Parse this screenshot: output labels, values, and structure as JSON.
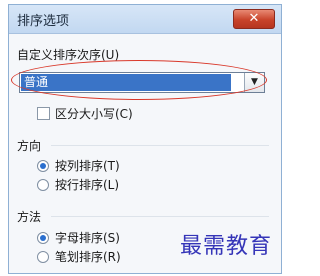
{
  "dialog": {
    "title": "排序选项",
    "close_glyph": "✕"
  },
  "custom_order": {
    "label": "自定义排序次序(U)",
    "selected_value": "普通",
    "arrow_glyph": "▼"
  },
  "case_sensitive": {
    "label": "区分大小写(C)",
    "checked": false
  },
  "direction": {
    "heading": "方向",
    "options": [
      {
        "label": "按列排序(T)",
        "checked": true
      },
      {
        "label": "按行排序(L)",
        "checked": false
      }
    ]
  },
  "method": {
    "heading": "方法",
    "options": [
      {
        "label": "字母排序(S)",
        "checked": true
      },
      {
        "label": "笔划排序(R)",
        "checked": false
      }
    ]
  },
  "watermark": "最需教育",
  "colors": {
    "highlight_ring": "#d9392b",
    "selection": "#3a74c7",
    "watermark": "#3535b8",
    "close_button": "#c8432a"
  }
}
